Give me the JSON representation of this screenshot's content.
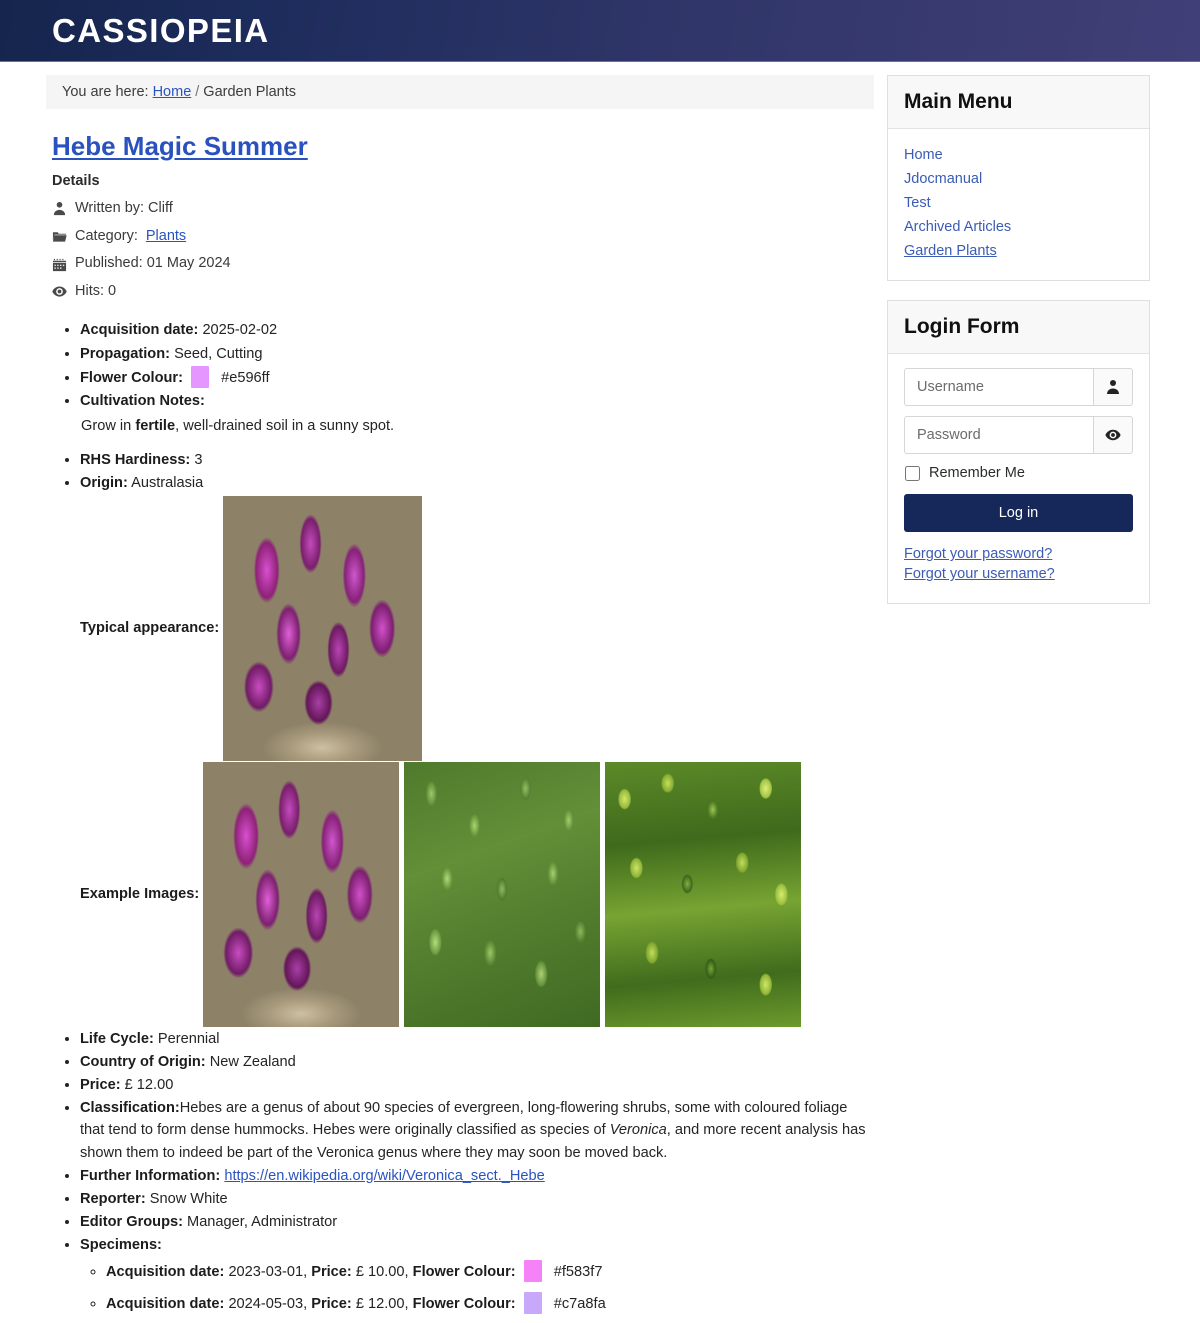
{
  "header": {
    "brand": "CASSIOPEIA"
  },
  "breadcrumb": {
    "prefix": "You are here:",
    "home": "Home",
    "separator": "/",
    "current": "Garden Plants"
  },
  "article": {
    "title": "Hebe Magic Summer",
    "details_heading": "Details",
    "meta": [
      {
        "icon": "user-icon",
        "label": "Written by: Cliff"
      },
      {
        "icon": "folder-icon",
        "label_prefix": "Category:",
        "link": "Plants"
      },
      {
        "icon": "calendar-icon",
        "label": "Published: 01 May 2024"
      },
      {
        "icon": "eye-icon",
        "label": "Hits: 0"
      }
    ],
    "attributes": {
      "acquisition_date_label": "Acquisition date:",
      "acquisition_date_value": "2025-02-02",
      "propagation_label": "Propagation:",
      "propagation_value": "Seed, Cutting",
      "flower_colour_label": "Flower Colour:",
      "flower_colour_value": "#e596ff",
      "flower_colour_hex": "#e596ff",
      "cultivation_notes_label": "Cultivation Notes:",
      "cultivation_notes_pre": "Grow in ",
      "cultivation_notes_bold": "fertile",
      "cultivation_notes_post": ", well-drained soil in a sunny spot.",
      "rhs_hardiness_label": "RHS Hardiness:",
      "rhs_hardiness_value": "3",
      "origin_label": "Origin:",
      "origin_value": "Australasia",
      "typical_appearance_label": "Typical appearance:",
      "example_images_label": "Example Images:",
      "life_cycle_label": "Life Cycle:",
      "life_cycle_value": "Perennial",
      "country_of_origin_label": "Country of Origin:",
      "country_of_origin_value": "New Zealand",
      "price_label": "Price:",
      "price_value": "£ 12.00",
      "classification_label": "Classification:",
      "classification_part1": "Hebes are a genus of about 90 species of evergreen, long-flowering shrubs, some with coloured foliage that tend to form dense hummocks. Hebes were originally classified as species of ",
      "classification_italic": "Veronica",
      "classification_part2": ", and more recent analysis has shown them to indeed be part of the Veronica genus where they may soon be moved back.",
      "further_information_label": "Further Information:",
      "further_information_url": "https://en.wikipedia.org/wiki/Veronica_sect._Hebe",
      "reporter_label": "Reporter:",
      "reporter_value": "Snow White",
      "editor_groups_label": "Editor Groups:",
      "editor_groups_value": "Manager, Administrator",
      "specimens_label": "Specimens:"
    },
    "images": {
      "typical": {
        "alt": "typical-appearance-photo"
      },
      "examples": [
        {
          "alt": "example-image-purple-hebe"
        },
        {
          "alt": "example-image-green-hebe"
        },
        {
          "alt": "example-image-yellow-green-hebe"
        }
      ]
    },
    "specimens": [
      {
        "acq_label": "Acquisition date:",
        "acq_value": "2023-03-01",
        "sep": ",",
        "price_label": "Price:",
        "price_value": "£ 10.00,",
        "colour_label": "Flower Colour:",
        "colour_value": "#f583f7",
        "colour_hex": "#f583f7"
      },
      {
        "acq_label": "Acquisition date:",
        "acq_value": "2024-05-03",
        "sep": ",",
        "price_label": "Price:",
        "price_value": "£ 12.00,",
        "colour_label": "Flower Colour:",
        "colour_value": "#c7a8fa",
        "colour_hex": "#c7a8fa"
      }
    ]
  },
  "sidebar": {
    "main_menu": {
      "title": "Main Menu",
      "items": [
        {
          "label": "Home",
          "active": false
        },
        {
          "label": "Jdocmanual",
          "active": false
        },
        {
          "label": "Test",
          "active": false
        },
        {
          "label": "Archived Articles",
          "active": false
        },
        {
          "label": "Garden Plants",
          "active": true
        }
      ]
    },
    "login_form": {
      "title": "Login Form",
      "username_placeholder": "Username",
      "username_value": "",
      "password_placeholder": "Password",
      "password_value": "",
      "remember_label": "Remember Me",
      "login_button": "Log in",
      "forgot_password": "Forgot your password?",
      "forgot_username": "Forgot your username?"
    }
  },
  "colors": {
    "header_gradient_start": "#15254d",
    "header_gradient_end": "#413f77",
    "link": "#2a53c1",
    "title_link": "#2a52be",
    "button_navy": "#16275a",
    "breadcrumb_bg": "#f5f5f5"
  }
}
